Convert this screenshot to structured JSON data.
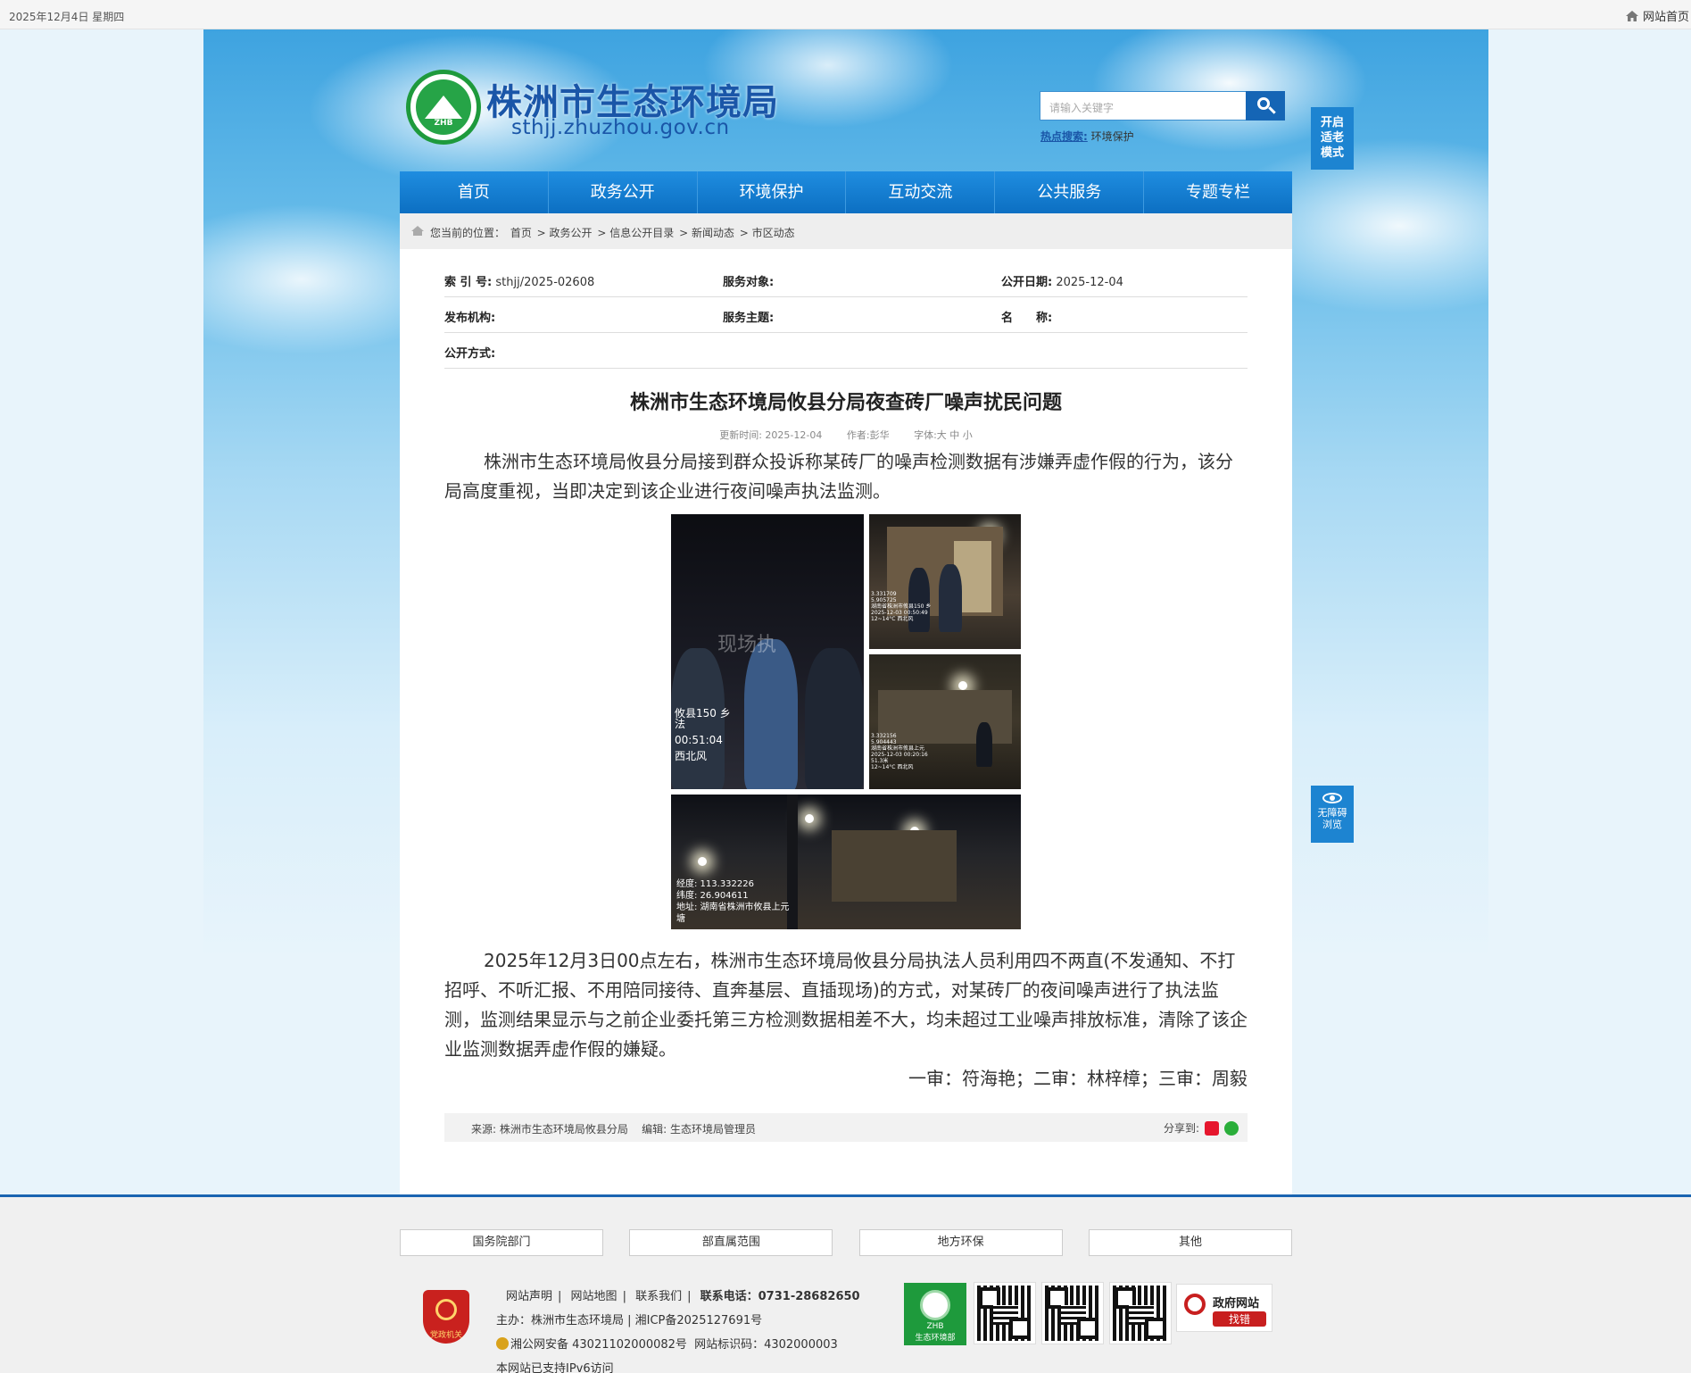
{
  "topbar": {
    "date": "2025年12月4日 星期四",
    "home_link": "网站首页"
  },
  "header": {
    "site_title": "株洲市生态环境局",
    "site_domain": "sthjj.zhuzhou.gov.cn",
    "logo_text": "ZHB",
    "search_placeholder": "请输入关键字",
    "hot_label": "热点搜索:",
    "hot_term": "环境保护",
    "elder_mode": "开启适老模式",
    "accessibility": "无障碍浏览"
  },
  "nav": {
    "items": [
      "首页",
      "政务公开",
      "环境保护",
      "互动交流",
      "公共服务",
      "专题专栏"
    ]
  },
  "breadcrumb": {
    "prefix": "您当前的位置：",
    "items": [
      "首页",
      "政务公开",
      "信息公开目录",
      "新闻动态",
      "市区动态"
    ]
  },
  "meta": {
    "index_label": "索 引 号:",
    "index_value": "sthjj/2025-02608",
    "service_target_label": "服务对象:",
    "service_target_value": "",
    "public_date_label": "公开日期:",
    "public_date_value": "2025-12-04",
    "publisher_label": "发布机构:",
    "publisher_value": "",
    "service_topic_label": "服务主题:",
    "service_topic_value": "",
    "name_label": "名　　称:",
    "name_value": "",
    "public_method_label": "公开方式:",
    "public_method_value": ""
  },
  "article": {
    "title": "株洲市生态环境局攸县分局夜查砖厂噪声扰民问题",
    "update_label": "更新时间: 2025-12-04",
    "author_label": "作者:彭华",
    "font_label": "字体:大 中 小",
    "para1": "株洲市生态环境局攸县分局接到群众投诉称某砖厂的噪声检测数据有涉嫌弄虚作假的行为，该分局高度重视，当即决定到该企业进行夜间噪声执法监测。",
    "para2": "2025年12月3日00点左右，株洲市生态环境局攸县分局执法人员利用四不两直(不发通知、不打招呼、不听汇报、不用陪同接待、直奔基层、直插现场)的方式，对某砖厂的夜间噪声进行了执法监测，监测结果显示与之前企业委托第三方检测数据相差不大，均未超过工业噪声排放标准，清除了该企业监测数据弄虚作假的嫌疑。",
    "reviewers": "一审：符海艳；二审：林梓樟；三审：周毅",
    "photo1_overlay": [
      "攸县150 乡",
      "法",
      "00:51:04",
      "",
      "西北风"
    ],
    "photo1_watermark": "现场执",
    "photo2_overlay": [
      "3.331709",
      "5.905725",
      "湖南省株洲市攸县150 乡",
      "2025-12-03 00:50:49",
      "",
      "12~14°C 西北风"
    ],
    "photo3_overlay": [
      "3.332156",
      "5.904443",
      "湖南省株洲市攸县上元",
      "2025-12-03 00:20:16",
      "51.3米",
      "12~14°C 西北风"
    ],
    "photo4_overlay": [
      "经度: 113.332226",
      "纬度: 26.904611",
      "地址: 湖南省株洲市攸县上元",
      "塘"
    ]
  },
  "source_bar": {
    "source": "来源: 株洲市生态环境局攸县分局",
    "editor": "编辑: 生态环境局管理员",
    "share_label": "分享到:"
  },
  "footer": {
    "link_groups": [
      "国务院部门",
      "部直属范围",
      "地方环保",
      "其他"
    ],
    "links": [
      "网站声明",
      "网站地图",
      "联系我们"
    ],
    "phone": "联系电话：0731-28682650",
    "host": "主办：株洲市生态环境局 | 湘ICP备2025127691号",
    "police": "湘公网安备 43021102000082号",
    "site_id": "网站标识码：4302000003",
    "ipv6": "本网站已支持IPv6访问",
    "party_badge": "党政机关",
    "zhb_label": "ZHB",
    "zhb_name": "生态环境部",
    "gov_error_1": "政府网站",
    "gov_error_2": "找错"
  },
  "colors": {
    "nav_blue": "#1f8de0",
    "title_blue": "#1a56a8",
    "footer_rule": "#1a64b1"
  }
}
